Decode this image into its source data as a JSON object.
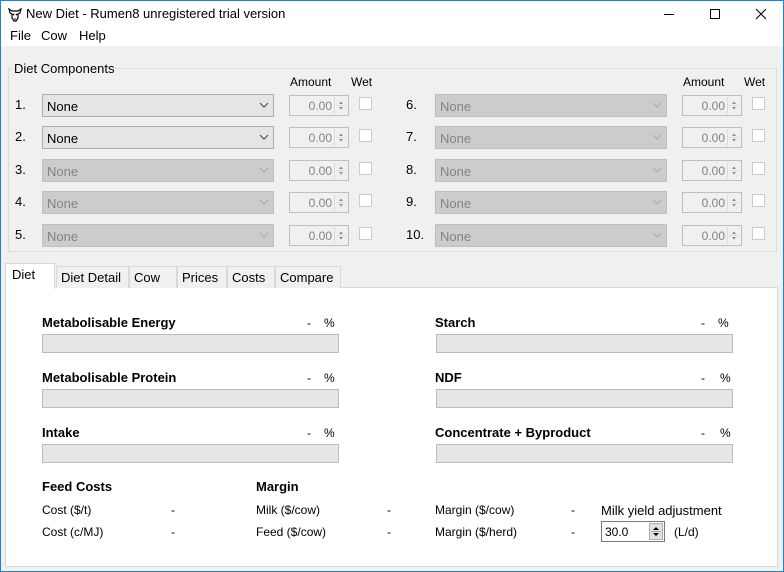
{
  "window": {
    "title": "New Diet - Rumen8 unregistered trial version",
    "icon": "cow-head-icon",
    "controls": [
      "minimize",
      "maximize",
      "close"
    ]
  },
  "menu": {
    "items": [
      {
        "label": "File"
      },
      {
        "label": "Cow"
      },
      {
        "label": "Help"
      }
    ]
  },
  "diet_components": {
    "title": "Diet Components",
    "amount_header": "Amount",
    "wet_header": "Wet",
    "rows": [
      {
        "num": "1.",
        "feed": "None",
        "amount": "0.00",
        "wet": false,
        "enabled": true
      },
      {
        "num": "2.",
        "feed": "None",
        "amount": "0.00",
        "wet": false,
        "enabled": true
      },
      {
        "num": "3.",
        "feed": "None",
        "amount": "0.00",
        "wet": false,
        "enabled": false
      },
      {
        "num": "4.",
        "feed": "None",
        "amount": "0.00",
        "wet": false,
        "enabled": false
      },
      {
        "num": "5.",
        "feed": "None",
        "amount": "0.00",
        "wet": false,
        "enabled": false
      },
      {
        "num": "6.",
        "feed": "None",
        "amount": "0.00",
        "wet": false,
        "enabled": false
      },
      {
        "num": "7.",
        "feed": "None",
        "amount": "0.00",
        "wet": false,
        "enabled": false
      },
      {
        "num": "8.",
        "feed": "None",
        "amount": "0.00",
        "wet": false,
        "enabled": false
      },
      {
        "num": "9.",
        "feed": "None",
        "amount": "0.00",
        "wet": false,
        "enabled": false
      },
      {
        "num": "10.",
        "feed": "None",
        "amount": "0.00",
        "wet": false,
        "enabled": false
      }
    ]
  },
  "tabs": [
    {
      "label": "Diet",
      "active": true
    },
    {
      "label": "Diet Detail",
      "active": false
    },
    {
      "label": "Cow",
      "active": false
    },
    {
      "label": "Prices",
      "active": false
    },
    {
      "label": "Costs",
      "active": false
    },
    {
      "label": "Compare",
      "active": false
    }
  ],
  "diet_tab": {
    "metrics": [
      {
        "label": "Metabolisable Energy",
        "value": "-",
        "unit": "%",
        "progress": 0
      },
      {
        "label": "Metabolisable Protein",
        "value": "-",
        "unit": "%",
        "progress": 0
      },
      {
        "label": "Intake",
        "value": "-",
        "unit": "%",
        "progress": 0
      },
      {
        "label": "Starch",
        "value": "-",
        "unit": "%",
        "progress": 0
      },
      {
        "label": "NDF",
        "value": "-",
        "unit": "%",
        "progress": 0
      },
      {
        "label": "Concentrate + Byproduct",
        "value": "-",
        "unit": "%",
        "progress": 0
      }
    ],
    "feed_costs": {
      "title": "Feed Costs",
      "items": [
        {
          "label": "Cost ($/t)",
          "value": "-"
        },
        {
          "label": "Cost (c/MJ)",
          "value": "-"
        }
      ]
    },
    "margin": {
      "title": "Margin",
      "items": [
        {
          "label": "Milk ($/cow)",
          "value": "-"
        },
        {
          "label": "Feed ($/cow)",
          "value": "-"
        },
        {
          "label": "Margin ($/cow)",
          "value": "-"
        },
        {
          "label": "Margin ($/herd)",
          "value": "-"
        }
      ]
    },
    "milk_yield": {
      "label": "Milk yield adjustment",
      "value": "30.0",
      "unit": "(L/d)"
    }
  }
}
